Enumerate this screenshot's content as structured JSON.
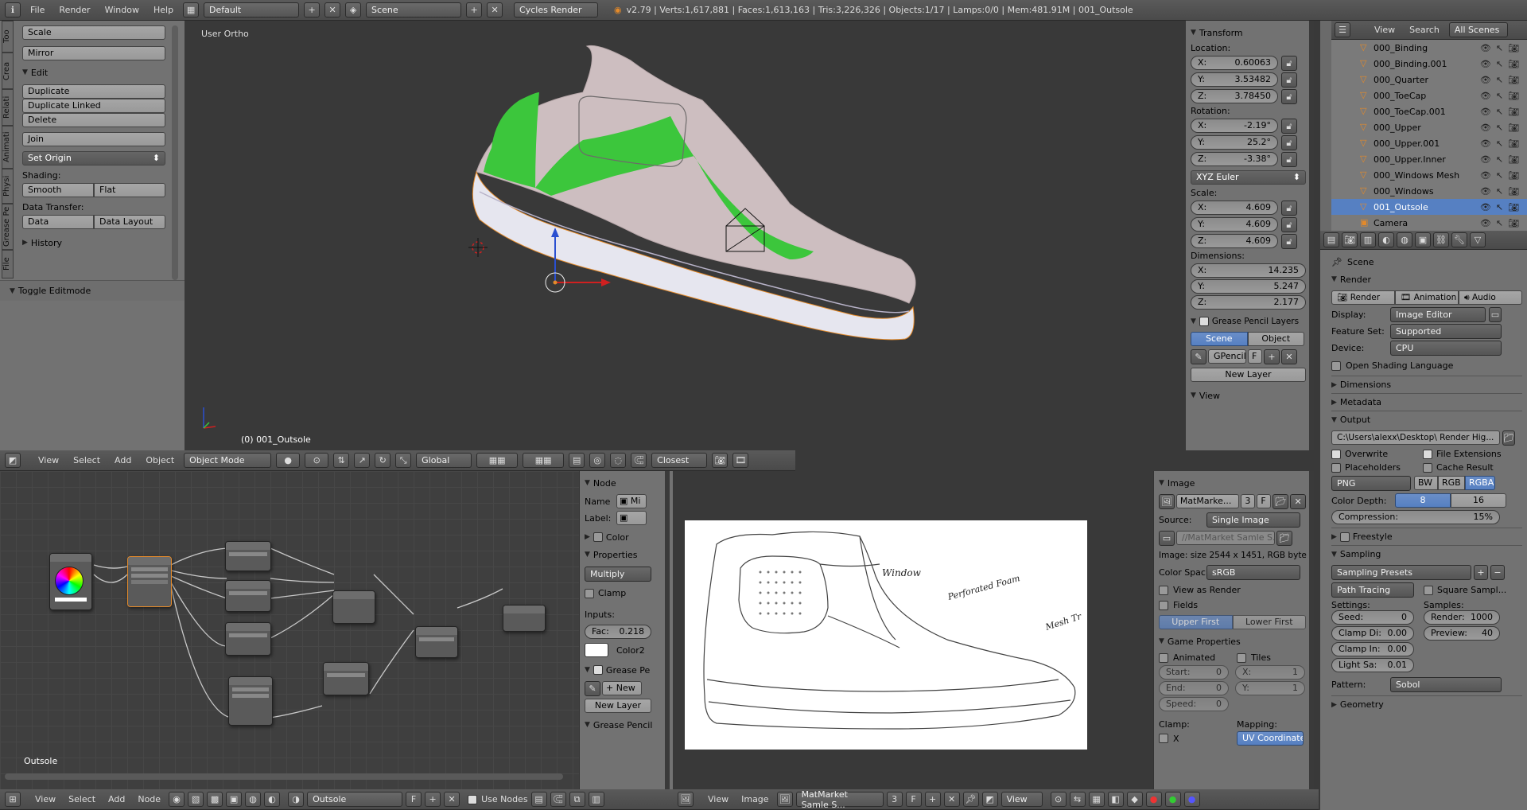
{
  "topbar": {
    "menus": [
      "File",
      "Render",
      "Window",
      "Help"
    ],
    "layout": "Default",
    "scene": "Scene",
    "engine": "Cycles Render",
    "stats": "v2.79 | Verts:1,617,881 | Faces:1,613,163 | Tris:3,226,326 | Objects:1/17 | Lamps:0/0 | Mem:481.91M | 001_Outsole"
  },
  "tool_shelf": {
    "tabs": [
      "Too",
      "Crea",
      "Relati",
      "Animati",
      "Physi",
      "Grease Pe",
      "File"
    ],
    "transform_buttons": [
      "Scale",
      "Mirror"
    ],
    "edit_title": "Edit",
    "edit_buttons": [
      "Duplicate",
      "Duplicate Linked",
      "Delete",
      "Join"
    ],
    "set_origin": "Set Origin",
    "shading_label": "Shading:",
    "smooth": "Smooth",
    "flat": "Flat",
    "data_transfer_label": "Data Transfer:",
    "data": "Data",
    "data_layout": "Data Layout",
    "history": "History",
    "toggle_editmode": "Toggle Editmode"
  },
  "viewport": {
    "view_label": "User Ortho",
    "object_label": "(0) 001_Outsole",
    "header": {
      "menus": [
        "View",
        "Select",
        "Add",
        "Object"
      ],
      "mode": "Object Mode",
      "orientation": "Global",
      "snap": "Closest"
    }
  },
  "transform_panel": {
    "title": "Transform",
    "location_label": "Location:",
    "location": {
      "x": "0.60063",
      "y": "3.53482",
      "z": "3.78450"
    },
    "rotation_label": "Rotation:",
    "rotation": {
      "x": "-2.19°",
      "y": "25.2°",
      "z": "-3.38°"
    },
    "rotation_mode": "XYZ Euler",
    "scale_label": "Scale:",
    "scale": {
      "x": "4.609",
      "y": "4.609",
      "z": "4.609"
    },
    "dimensions_label": "Dimensions:",
    "dimensions": {
      "x": "14.235",
      "y": "5.247",
      "z": "2.177"
    },
    "grease_title": "Grease Pencil Layers",
    "gp_scene": "Scene",
    "gp_object": "Object",
    "gp_name": "GPencil.",
    "gp_f": "F",
    "new_layer": "New Layer",
    "view_title": "View",
    "axis_labels": {
      "x": "X:",
      "y": "Y:",
      "z": "Z:"
    }
  },
  "outliner": {
    "header": {
      "view": "View",
      "search": "Search",
      "scenes": "All Scenes"
    },
    "items": [
      "000_Binding",
      "000_Binding.001",
      "000_Quarter",
      "000_ToeCap",
      "000_ToeCap.001",
      "000_Upper",
      "000_Upper.001",
      "000_Upper.Inner",
      "000_Windows Mesh",
      "000_Windows",
      "001_Outsole",
      "Camera"
    ]
  },
  "properties": {
    "scene_label": "Scene",
    "render_title": "Render",
    "render_btn": "Render",
    "animation_btn": "Animation",
    "audio_btn": "Audio",
    "display_label": "Display:",
    "display": "Image Editor",
    "feature_label": "Feature Set:",
    "feature": "Supported",
    "device_label": "Device:",
    "device": "CPU",
    "osl": "Open Shading Language",
    "dimensions": "Dimensions",
    "metadata": "Metadata",
    "output_title": "Output",
    "output_path": "C:\\Users\\alexx\\Desktop\\ Render Hig...",
    "overwrite": "Overwrite",
    "file_ext": "File Extensions",
    "placeholders": "Placeholders",
    "cache": "Cache Result",
    "format": "PNG",
    "bw": "BW",
    "rgb": "RGB",
    "rgba": "RGBA",
    "color_depth_label": "Color Depth:",
    "depth8": "8",
    "depth16": "16",
    "compression": "Compression:",
    "compression_val": "15%",
    "freestyle": "Freestyle",
    "sampling_title": "Sampling",
    "sampling_presets": "Sampling Presets",
    "path_tracing": "Path Tracing",
    "square_samples": "Square Sampl...",
    "settings_label": "Settings:",
    "samples_label": "Samples:",
    "seed": "Seed:",
    "seed_val": "0",
    "clamp_direct": "Clamp Di:",
    "clamp_direct_val": "0.00",
    "clamp_indirect": "Clamp In:",
    "clamp_indirect_val": "0.00",
    "light_sa": "Light Sa:",
    "light_sa_val": "0.01",
    "render_samples": "Render:",
    "render_samples_val": "1000",
    "preview_samples": "Preview:",
    "preview_samples_val": "40",
    "pattern_label": "Pattern:",
    "pattern": "Sobol",
    "geometry": "Geometry"
  },
  "node_editor": {
    "tree_label": "Outsole",
    "header": {
      "menus": [
        "View",
        "Select",
        "Add",
        "Node"
      ],
      "material": "Outsole",
      "f": "F",
      "use_nodes": "Use Nodes"
    },
    "panel": {
      "node_title": "Node",
      "name_label": "Name",
      "name_val": "Mi",
      "label_label": "Label:",
      "color": "Color",
      "properties": "Properties",
      "blend": "Multiply",
      "clamp": "Clamp",
      "inputs": "Inputs:",
      "fac": "Fac:",
      "fac_val": "0.218",
      "color2": "Color2",
      "grease": "Grease Pe",
      "new": "New",
      "new_layer": "New Layer",
      "grease2": "Grease Pencil"
    }
  },
  "image_editor": {
    "header": {
      "menus": [
        "View",
        "Image"
      ],
      "image": "MatMarket Samle S...",
      "users": "3",
      "f": "F",
      "view": "View"
    },
    "sketch_labels": [
      "Window",
      "Perforated Foam",
      "Mesh Tr"
    ],
    "panel": {
      "image_title": "Image",
      "image_name": "MatMarke...",
      "users": "3",
      "f": "F",
      "source_label": "Source:",
      "source": "Single Image",
      "path": "//MatMarket Samle S...",
      "info": "Image: size 2544 x 1451, RGB byte",
      "colorspace_label": "Color Spac",
      "colorspace": "sRGB",
      "view_as_render": "View as Render",
      "fields": "Fields",
      "upper_first": "Upper First",
      "lower_first": "Lower First",
      "game_props": "Game Properties",
      "animated": "Animated",
      "tiles": "Tiles",
      "start": "Start:",
      "start_val": "0",
      "end": "End:",
      "end_val": "0",
      "speed": "Speed:",
      "speed_val": "0",
      "tx": "X:",
      "tx_val": "1",
      "ty": "Y:",
      "ty_val": "1",
      "clamp_label": "Clamp:",
      "mapping_label": "Mapping:",
      "clamp_x": "X",
      "mapping": "UV Coordinates"
    }
  },
  "colors": {
    "accent": "#5680c2",
    "selection": "#e48a2a",
    "green": "#3cc63c",
    "bg": "#393939",
    "panel": "#727272"
  }
}
